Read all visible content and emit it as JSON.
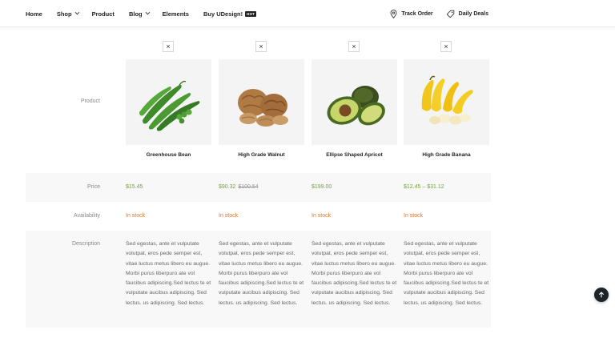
{
  "nav": {
    "items": [
      {
        "label": "Home",
        "dropdown": false
      },
      {
        "label": "Shop",
        "dropdown": true
      },
      {
        "label": "Product",
        "dropdown": false
      },
      {
        "label": "Blog",
        "dropdown": true
      },
      {
        "label": "Elements",
        "dropdown": false
      },
      {
        "label": "Buy UDesign!",
        "dropdown": false
      }
    ],
    "hot_badge": "HOT",
    "track_order": "Track Order",
    "daily_deals": "Daily Deals"
  },
  "compare": {
    "labels": {
      "product": "Product",
      "price": "Price",
      "availability": "Availability",
      "description": "Description"
    },
    "remove_symbol": "×",
    "products": [
      {
        "name": "Greenhouse Bean",
        "image": "green-beans",
        "price": "$15.45",
        "price_old": "",
        "availability": "In stock",
        "description": "Sed egestas, ante et vulputate volutpat, eros pede semper est, vitae luctus metus libero eu augue. Morbi purus liberpuro ate vol faucibus adipiscing.Sed lectus te et vulputate aucibus adipiscing. Sed lectus. us adipiscing. Sed lectus."
      },
      {
        "name": "High Grade Walnut",
        "image": "walnuts",
        "price": "$90.32",
        "price_old": "$100.54",
        "availability": "In stock",
        "description": "Sed egestas, ante et vulputate volutpat, eros pede semper est, vitae luctus metus libero eu augue. Morbi purus liberpuro ate vol faucibus adipiscing.Sed lectus te et vulputate aucibus adipiscing. Sed lectus. us adipiscing. Sed lectus."
      },
      {
        "name": "Ellipse Shaped Apricot",
        "image": "avocado",
        "price": "$199.00",
        "price_old": "",
        "availability": "In stock",
        "description": "Sed egestas, ante et vulputate volutpat, eros pede semper est, vitae luctus metus libero eu augue. Morbi purus liberpuro ate vol faucibus adipiscing.Sed lectus te et vulputate aucibus adipiscing. Sed lectus. us adipiscing. Sed lectus."
      },
      {
        "name": "High Grade Banana",
        "image": "bananas",
        "price": "$12.45 – $31.12",
        "price_old": "",
        "availability": "In stock",
        "description": "Sed egestas, ante et vulputate volutpat, eros pede semper est, vitae luctus metus libero eu augue. Morbi purus liberpuro ate vol faucibus adipiscing.Sed lectus te et vulputate aucibus adipiscing. Sed lectus. us adipiscing. Sed lectus."
      }
    ]
  },
  "colors": {
    "price_green": "#75a33a",
    "stock_orange": "#e2731f",
    "row_shade": "#f8f8f8"
  }
}
